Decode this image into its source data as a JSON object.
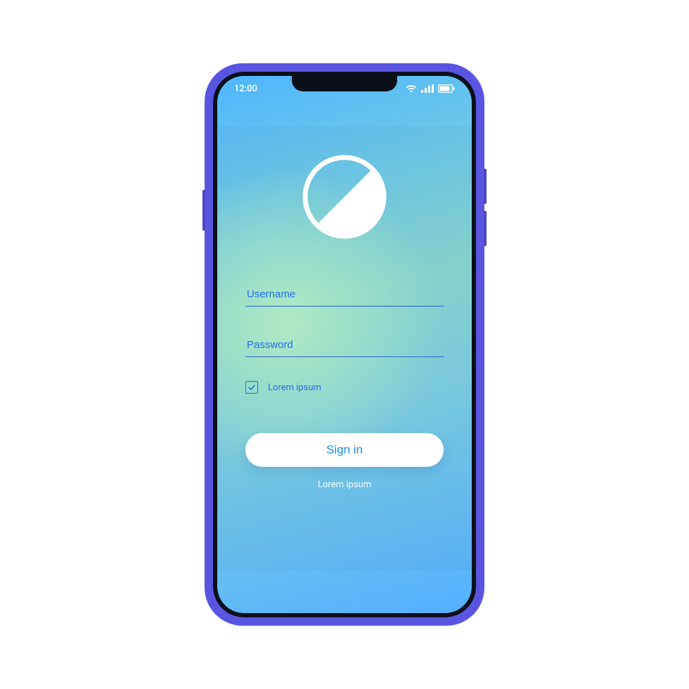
{
  "status": {
    "time": "12:00",
    "icons": [
      "wifi-icon",
      "signal-icon",
      "battery-icon"
    ]
  },
  "logo": {
    "name": "app-logo-icon"
  },
  "form": {
    "username_placeholder": "Username",
    "password_placeholder": "Password",
    "checkbox_checked": true,
    "checkbox_label": "Lorem ipsum",
    "signin_label": "Sign in",
    "footer_label": "Lorem ipsum"
  },
  "colors": {
    "frame": "#5a55e0",
    "accent": "#1f6fea",
    "button_bg": "#ffffff",
    "button_text": "#1f8be6"
  }
}
